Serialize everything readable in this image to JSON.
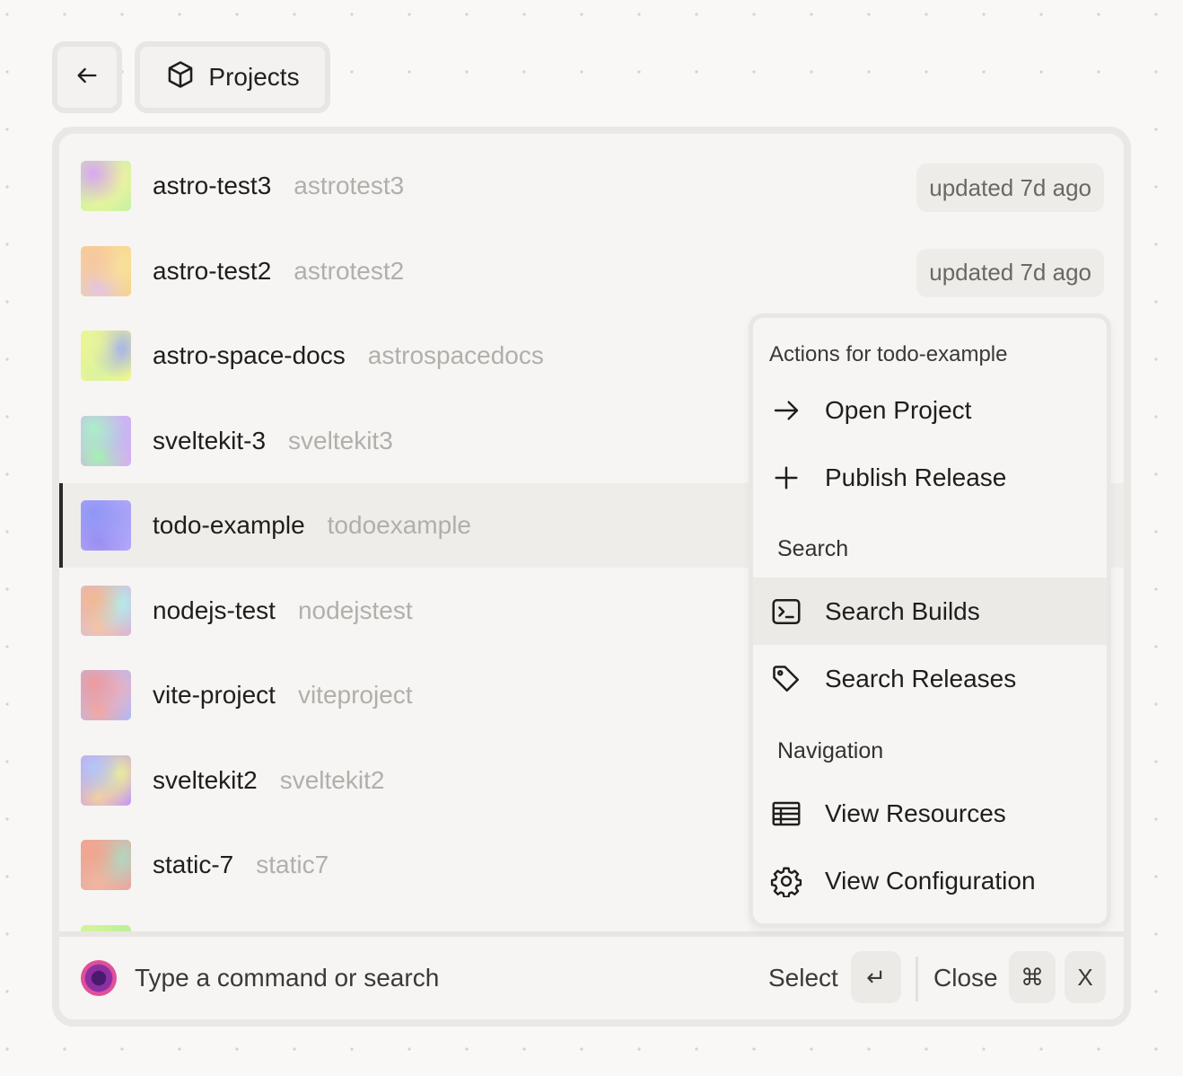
{
  "header": {
    "back_icon": "arrow-left-icon",
    "projects_label": "Projects",
    "projects_icon": "box-icon"
  },
  "projects": [
    {
      "name": "astro-test3",
      "slug": "astrotest3",
      "updated": "updated 7d ago",
      "colors": [
        "#d9a7f0",
        "#f1f2a0",
        "#e7f59c",
        "#c9f1a4"
      ]
    },
    {
      "name": "astro-test2",
      "slug": "astrotest2",
      "updated": "updated 7d ago",
      "colors": [
        "#f6c7a1",
        "#f9e39a",
        "#e2c3e8",
        "#f7d48f"
      ]
    },
    {
      "name": "astro-space-docs",
      "slug": "astrospacedocs",
      "colors": [
        "#e6f59a",
        "#9eaaf5",
        "#d8f2a0",
        "#f0f58f"
      ]
    },
    {
      "name": "sveltekit-3",
      "slug": "sveltekit3",
      "colors": [
        "#a8f0c8",
        "#c3b9f2",
        "#a4f1b0",
        "#d6aef0"
      ]
    },
    {
      "name": "todo-example",
      "slug": "todoexample",
      "colors": [
        "#8f95f6",
        "#a3a1f7",
        "#9a8ef0",
        "#b1a6fa"
      ]
    },
    {
      "name": "nodejs-test",
      "slug": "nodejstest",
      "colors": [
        "#f3b98f",
        "#aef0ef",
        "#f3c6a8",
        "#d9b7d5"
      ]
    },
    {
      "name": "vite-project",
      "slug": "viteproject",
      "colors": [
        "#ef9a9a",
        "#e7b2c6",
        "#f4a8a0",
        "#b6b9f0"
      ]
    },
    {
      "name": "sveltekit2",
      "slug": "sveltekit2",
      "colors": [
        "#b4c6f5",
        "#f1f28e",
        "#f6d19c",
        "#c69ef0"
      ]
    },
    {
      "name": "static-7",
      "slug": "static7",
      "colors": [
        "#f2a58f",
        "#a9ddc5",
        "#f2b7a0",
        "#e7a9a0"
      ]
    },
    {
      "name": "",
      "slug": "",
      "colors": [
        "#d6f59a",
        "#b5ee9c",
        "#e2f5a4",
        "#c7f09a"
      ]
    }
  ],
  "selected_index": 4,
  "menu": {
    "title": "Actions for todo-example",
    "items_top": [
      {
        "label": "Open Project",
        "icon": "arrow-right-icon"
      },
      {
        "label": "Publish Release",
        "icon": "plus-icon"
      }
    ],
    "section_search": "Search",
    "items_search": [
      {
        "label": "Search Builds",
        "icon": "terminal-icon"
      },
      {
        "label": "Search Releases",
        "icon": "tag-icon"
      }
    ],
    "section_navigation": "Navigation",
    "items_navigation": [
      {
        "label": "View Resources",
        "icon": "table-icon"
      },
      {
        "label": "View Configuration",
        "icon": "gear-icon"
      }
    ],
    "active_label": "Search Builds"
  },
  "footer": {
    "placeholder": "Type a command or search",
    "select_label": "Select",
    "select_key": "↵",
    "close_label": "Close",
    "close_key_1": "⌘",
    "close_key_2": "X"
  }
}
